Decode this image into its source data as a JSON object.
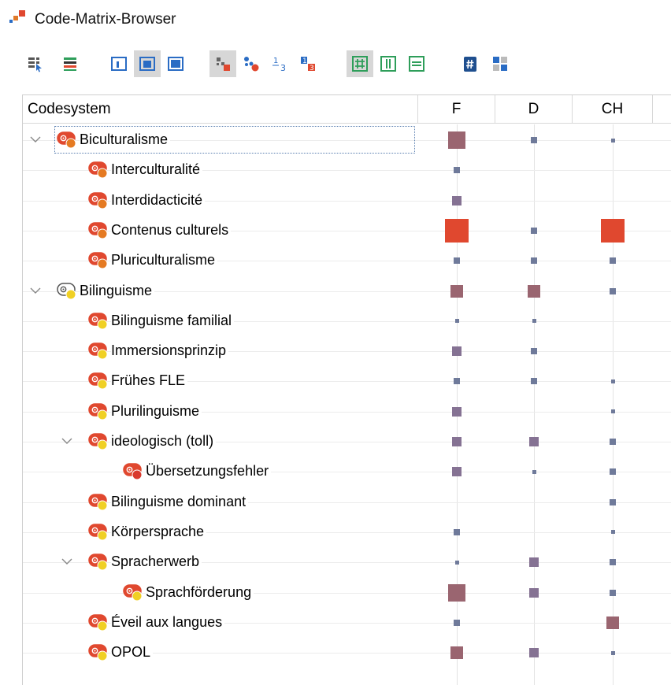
{
  "window": {
    "title": "Code-Matrix-Browser"
  },
  "colors": {
    "accent_red": "#e0482f",
    "mauve": "#9a6570",
    "slate": "#6f7a9a",
    "toolbar_blue": "#2a6cc4",
    "toolbar_green": "#2e9e5a",
    "dot_orange": "#e57a22",
    "dot_yellow": "#f0d024",
    "dot_red": "#d93a2e"
  },
  "toolbar": {
    "buttons": [
      {
        "name": "select-tool-icon",
        "active": false
      },
      {
        "name": "colored-lines-icon",
        "active": false
      },
      {
        "name": "layout-narrow-icon",
        "active": false
      },
      {
        "name": "layout-medium-icon",
        "active": true
      },
      {
        "name": "layout-wide-icon",
        "active": false
      },
      {
        "name": "symbol-squares-icon",
        "active": true
      },
      {
        "name": "symbol-circles-icon",
        "active": false
      },
      {
        "name": "symbol-numbers-icon",
        "active": false
      },
      {
        "name": "symbol-highlighted-numbers-icon",
        "active": false
      },
      {
        "name": "grid-view-icon",
        "active": true
      },
      {
        "name": "columns-view-icon",
        "active": false
      },
      {
        "name": "rows-view-icon",
        "active": false
      },
      {
        "name": "hash-icon",
        "active": false
      },
      {
        "name": "matrix-numbers-icon",
        "active": false
      }
    ]
  },
  "matrix": {
    "header": {
      "name_column": "Codesystem",
      "columns": [
        "F",
        "D",
        "CH"
      ]
    },
    "rows": [
      {
        "label": "Biculturalisme",
        "level": 0,
        "expandable": true,
        "dot": "orange",
        "selected": true,
        "values": [
          3,
          1,
          0.5
        ]
      },
      {
        "label": "Interculturalité",
        "level": 1,
        "expandable": false,
        "dot": "orange",
        "values": [
          1,
          0,
          0
        ]
      },
      {
        "label": "Interdidacticité",
        "level": 1,
        "expandable": false,
        "dot": "orange",
        "values": [
          1.5,
          0,
          0
        ]
      },
      {
        "label": "Contenus culturels",
        "level": 1,
        "expandable": false,
        "dot": "orange",
        "values": [
          4,
          1,
          4
        ]
      },
      {
        "label": "Pluriculturalisme",
        "level": 1,
        "expandable": false,
        "dot": "orange",
        "values": [
          1,
          1,
          1
        ]
      },
      {
        "label": "Bilinguisme",
        "level": 0,
        "expandable": true,
        "dot": "yellow",
        "plain": true,
        "values": [
          2,
          2,
          1
        ]
      },
      {
        "label": "Bilinguisme familial",
        "level": 1,
        "expandable": false,
        "dot": "yellow",
        "values": [
          0.5,
          0.5,
          0
        ]
      },
      {
        "label": "Immersionsprinzip",
        "level": 1,
        "expandable": false,
        "dot": "yellow",
        "values": [
          1.5,
          1,
          0
        ]
      },
      {
        "label": "Frühes FLE",
        "level": 1,
        "expandable": false,
        "dot": "yellow",
        "values": [
          1,
          1,
          0.5
        ]
      },
      {
        "label": "Plurilinguisme",
        "level": 1,
        "expandable": false,
        "dot": "yellow",
        "values": [
          1.5,
          0,
          0.5
        ]
      },
      {
        "label": "ideologisch (toll)",
        "level": 1,
        "expandable": true,
        "dot": "yellow",
        "values": [
          1.5,
          1.5,
          1
        ]
      },
      {
        "label": "Übersetzungsfehler",
        "level": 2,
        "expandable": false,
        "dot": "red",
        "values": [
          1.5,
          0.5,
          1
        ]
      },
      {
        "label": "Bilinguisme dominant",
        "level": 1,
        "expandable": false,
        "dot": "yellow",
        "values": [
          0,
          0,
          1
        ]
      },
      {
        "label": "Körpersprache",
        "level": 1,
        "expandable": false,
        "dot": "yellow",
        "values": [
          1,
          0,
          0.5
        ]
      },
      {
        "label": "Spracherwerb",
        "level": 1,
        "expandable": true,
        "dot": "yellow",
        "values": [
          0.5,
          1.5,
          1
        ]
      },
      {
        "label": "Sprachförderung",
        "level": 2,
        "expandable": false,
        "dot": "yellow",
        "values": [
          3,
          1.5,
          1
        ]
      },
      {
        "label": "Éveil aux langues",
        "level": 1,
        "expandable": false,
        "dot": "yellow",
        "values": [
          1,
          0,
          2
        ]
      },
      {
        "label": "OPOL",
        "level": 1,
        "expandable": false,
        "dot": "yellow",
        "values": [
          2,
          1.5,
          0.5
        ]
      }
    ]
  }
}
